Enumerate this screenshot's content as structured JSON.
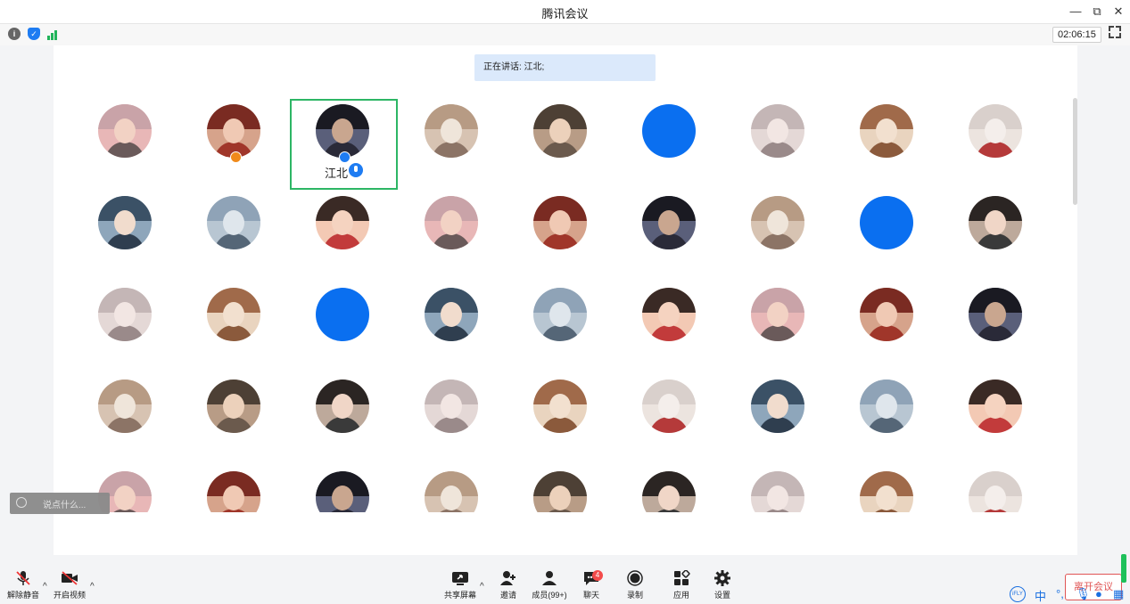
{
  "window": {
    "title": "腾讯会议",
    "controls": {
      "minimize": "—",
      "restore": "⧉",
      "close": "✕"
    }
  },
  "infobar": {
    "timer": "02:06:15",
    "icons": [
      "info-icon",
      "shield-icon",
      "signal-icon",
      "fullscreen-icon"
    ]
  },
  "speaking": {
    "text": "正在讲话: 江北;"
  },
  "active_participant": {
    "name": "江北"
  },
  "participants": {
    "rows": 5,
    "columns": 9,
    "blue_avatar_positions": [
      [
        0,
        5
      ],
      [
        1,
        7
      ],
      [
        2,
        2
      ]
    ]
  },
  "chat": {
    "placeholder": "说点什么..."
  },
  "toolbar": {
    "unmute": "解除静音",
    "start_video": "开启视频",
    "share_screen": "共享屏幕",
    "invite": "邀请",
    "members": "成员(99+)",
    "chat": "聊天",
    "chat_badge": "4",
    "record": "录制",
    "apps": "应用",
    "settings": "设置",
    "leave": "离开会议"
  },
  "ime": {
    "lang": "中"
  },
  "colors": {
    "accent": "#1e7cf2",
    "active_border": "#2db665",
    "speaking_bg": "#dbe9fb",
    "leave_red": "#e05555"
  }
}
